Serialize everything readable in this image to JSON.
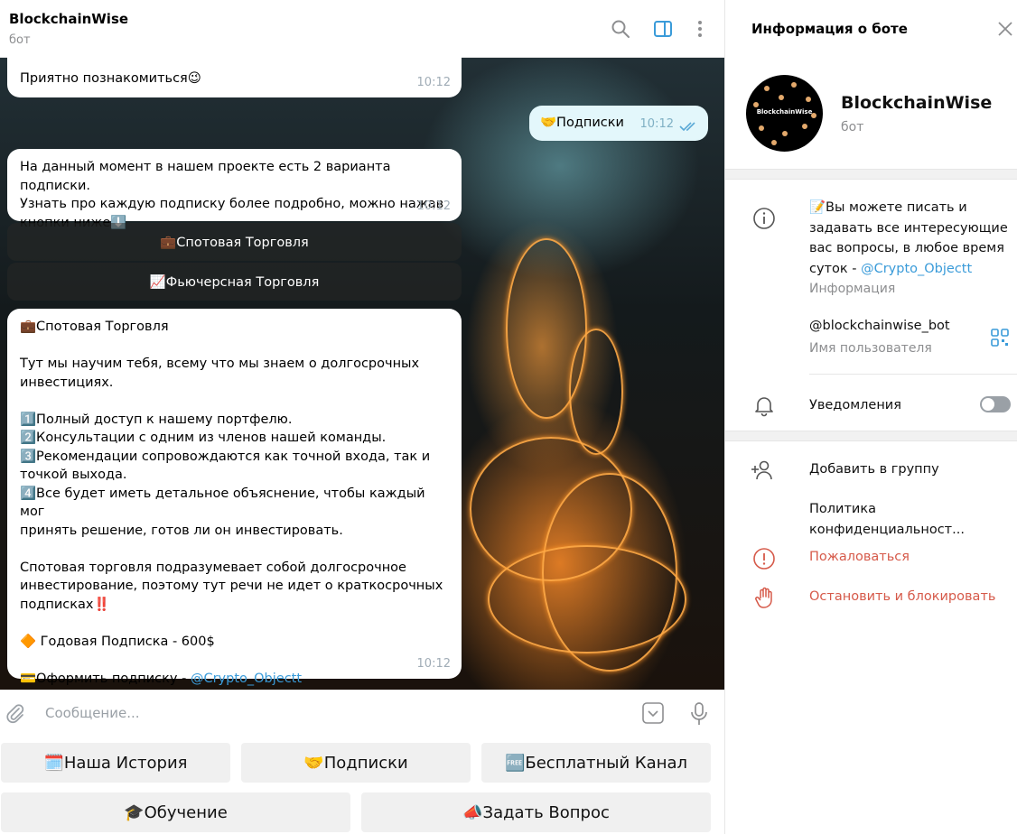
{
  "chat": {
    "title": "BlockchainWise",
    "subtitle": "бот",
    "messages": {
      "m1": {
        "text": "Приятно познакомиться😉",
        "time": "10:12"
      },
      "m2": {
        "text": "🤝Подписки",
        "time": "10:12"
      },
      "m3": {
        "line1": "На данный момент в нашем проекте есть 2 варианта подписки.",
        "line2": "Узнать про каждую подписку более подробно, можно нажав",
        "line3": "кнопки ниже⬇️",
        "time": "10:12"
      },
      "m4": {
        "title": "💼Спотовая Торговля",
        "p1a": "Тут мы научим тебя, всему что мы знаем о долгосрочных",
        "p1b": "инвестициях.",
        "l1": "1️⃣Полный доступ к нашему портфелю.",
        "l2": "2️⃣Консультации с одним из членов нашей команды.",
        "l3a": "3️⃣Рекомендации сопровождаются как точной входа, так и",
        "l3b": "точкой выхода.",
        "l4a": "4️⃣Все будет иметь детальное объяснение, чтобы каждый мог",
        "l4b": "принять решение, готов ли он инвестировать.",
        "p2a": "Спотовая торговля подразумевает собой долгосрочное",
        "p2b": "инвестирование, поэтому тут речи не идет о краткосрочных",
        "p2c": "подписках‼️",
        "price": "🔶 Годовая Подписка - 600$",
        "order_prefix": "💳Оформить подписку - ",
        "order_link": "@Crypto_Objectt",
        "time": "10:12"
      }
    },
    "inline_buttons": {
      "spot": "💼Спотовая Торговля",
      "futures": "📈Фьючерсная Торговля"
    },
    "composer": {
      "placeholder": "Сообщение..."
    },
    "reply_keyboard": {
      "history": "🗓️Наша История",
      "subs": "🤝Подписки",
      "free": "🆓Бесплатный Канал",
      "learn": "🎓Обучение",
      "ask": "📣Задать Вопрос"
    }
  },
  "panel": {
    "title": "Информация о боте",
    "bot_name": "BlockchainWise",
    "bot_sub": "бот",
    "avatar_text": "BlockchainWise",
    "about": {
      "l1": "📝Вы можете писать и",
      "l2": "задавать все интересующие",
      "l3": "вас вопросы, в любое время",
      "l4_prefix": "суток - ",
      "l4_link": "@Crypto_Objectt",
      "label": "Информация"
    },
    "username": {
      "value": "@blockchainwise_bot",
      "label": "Имя пользователя"
    },
    "notifications": "Уведомления",
    "add_to_group": "Добавить в группу",
    "privacy": "Политика конфиденциальност...",
    "report": "Пожаловаться",
    "block": "Остановить и блокировать"
  },
  "colors": {
    "link": "#3a9bd9",
    "danger": "#d65a4a",
    "accent": "#3a9bd9"
  }
}
